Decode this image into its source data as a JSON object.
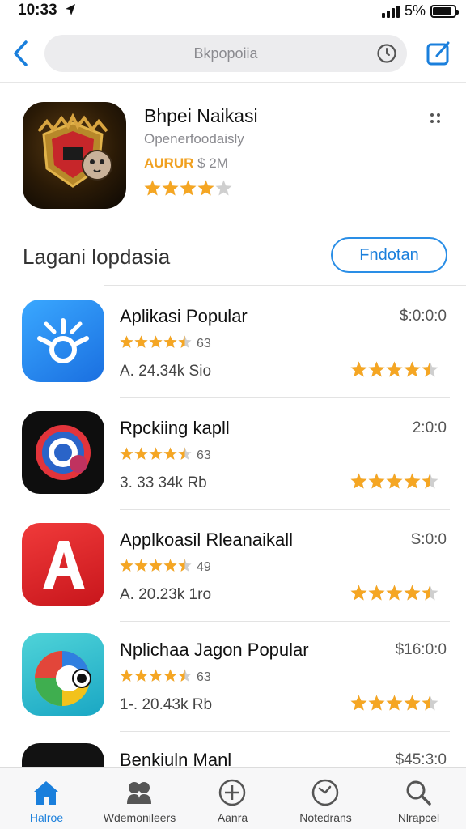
{
  "status_bar": {
    "time": "10:33",
    "battery_text": "5%",
    "battery_level": 0.9
  },
  "navbar": {
    "search_placeholder": "Bkpopoiia"
  },
  "featured": {
    "title": "Bhpei Naikasi",
    "subtitle": "Openerfoodaisly",
    "tag": "AURUR",
    "size": "$ 2M",
    "rating": 4
  },
  "section": {
    "title": "Lagani lopdasia",
    "button_label": "Fndotan"
  },
  "apps": [
    {
      "name": "Aplikasi Popular",
      "price": "$:0:0:0",
      "rating_count": "63",
      "stats": "A. 24.34k   Sio",
      "rating_small": 4.5,
      "rating_right": 4.5,
      "icon": "blue-gear-icon"
    },
    {
      "name": "Rpckiing kapll",
      "price": "2:0:0",
      "rating_count": "63",
      "stats": "3. 33 34k   Rb",
      "rating_small": 4.5,
      "rating_right": 4.5,
      "icon": "at-sign-icon"
    },
    {
      "name": "Applkoasil Rleanaikall",
      "price": "S:0:0",
      "rating_count": "49",
      "stats": "A. 20.23k   1ro",
      "rating_small": 4.5,
      "rating_right": 4.5,
      "icon": "letter-a-icon"
    },
    {
      "name": "Nplichaa Jagon Popular",
      "price": "$16:0:0",
      "rating_count": "63",
      "stats": "1-. 20.43k   Rb",
      "rating_small": 4.5,
      "rating_right": 4.5,
      "icon": "chrome-like-icon"
    },
    {
      "name": "Benkiuln Manl",
      "price": "$45:3:0",
      "rating_count": "",
      "stats": "",
      "rating_small": 0,
      "rating_right": 0,
      "icon": "red-dot-icon"
    }
  ],
  "tabs": [
    {
      "label": "Halroe",
      "icon": "home-icon",
      "active": true
    },
    {
      "label": "Wdemonileers",
      "icon": "people-icon",
      "active": false
    },
    {
      "label": "Aanra",
      "icon": "plus-circle-icon",
      "active": false
    },
    {
      "label": "Notedrans",
      "icon": "clock-icon",
      "active": false
    },
    {
      "label": "Nlrapcel",
      "icon": "search-icon",
      "active": false
    }
  ],
  "colors": {
    "accent": "#1a7fdc",
    "star": "#f5a623",
    "star_empty": "#cfcfcf"
  }
}
